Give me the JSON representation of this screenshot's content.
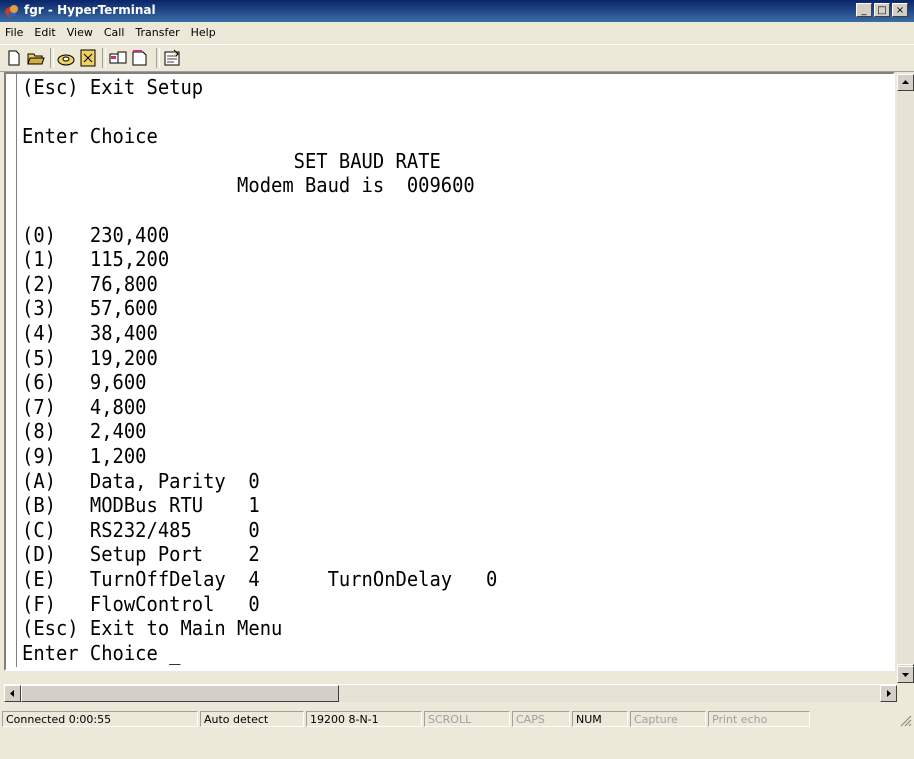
{
  "window": {
    "title": "fgr - HyperTerminal"
  },
  "menu": [
    "File",
    "Edit",
    "View",
    "Call",
    "Transfer",
    "Help"
  ],
  "terminal": {
    "lines": [
      "(Esc) Exit Setup",
      "",
      "Enter Choice",
      "                        SET BAUD RATE",
      "                   Modem Baud is  009600",
      "",
      "(0)   230,400",
      "(1)   115,200",
      "(2)   76,800",
      "(3)   57,600",
      "(4)   38,400",
      "(5)   19,200",
      "(6)   9,600",
      "(7)   4,800",
      "(8)   2,400",
      "(9)   1,200",
      "(A)   Data, Parity  0",
      "(B)   MODBus RTU    1",
      "(C)   RS232/485     0",
      "(D)   Setup Port    2",
      "(E)   TurnOffDelay  4      TurnOnDelay   0",
      "(F)   FlowControl   0",
      "(Esc) Exit to Main Menu",
      "Enter Choice _"
    ]
  },
  "status": {
    "connected": "Connected 0:00:55",
    "detect": "Auto detect",
    "settings": "19200 8-N-1",
    "scroll": "SCROLL",
    "caps": "CAPS",
    "num": "NUM",
    "capture": "Capture",
    "print_echo": "Print echo"
  },
  "icons": {
    "toolbar": [
      "new-icon",
      "open-icon",
      "connect-icon",
      "disconnect-icon",
      "send-icon",
      "receive-icon",
      "properties-icon"
    ]
  }
}
